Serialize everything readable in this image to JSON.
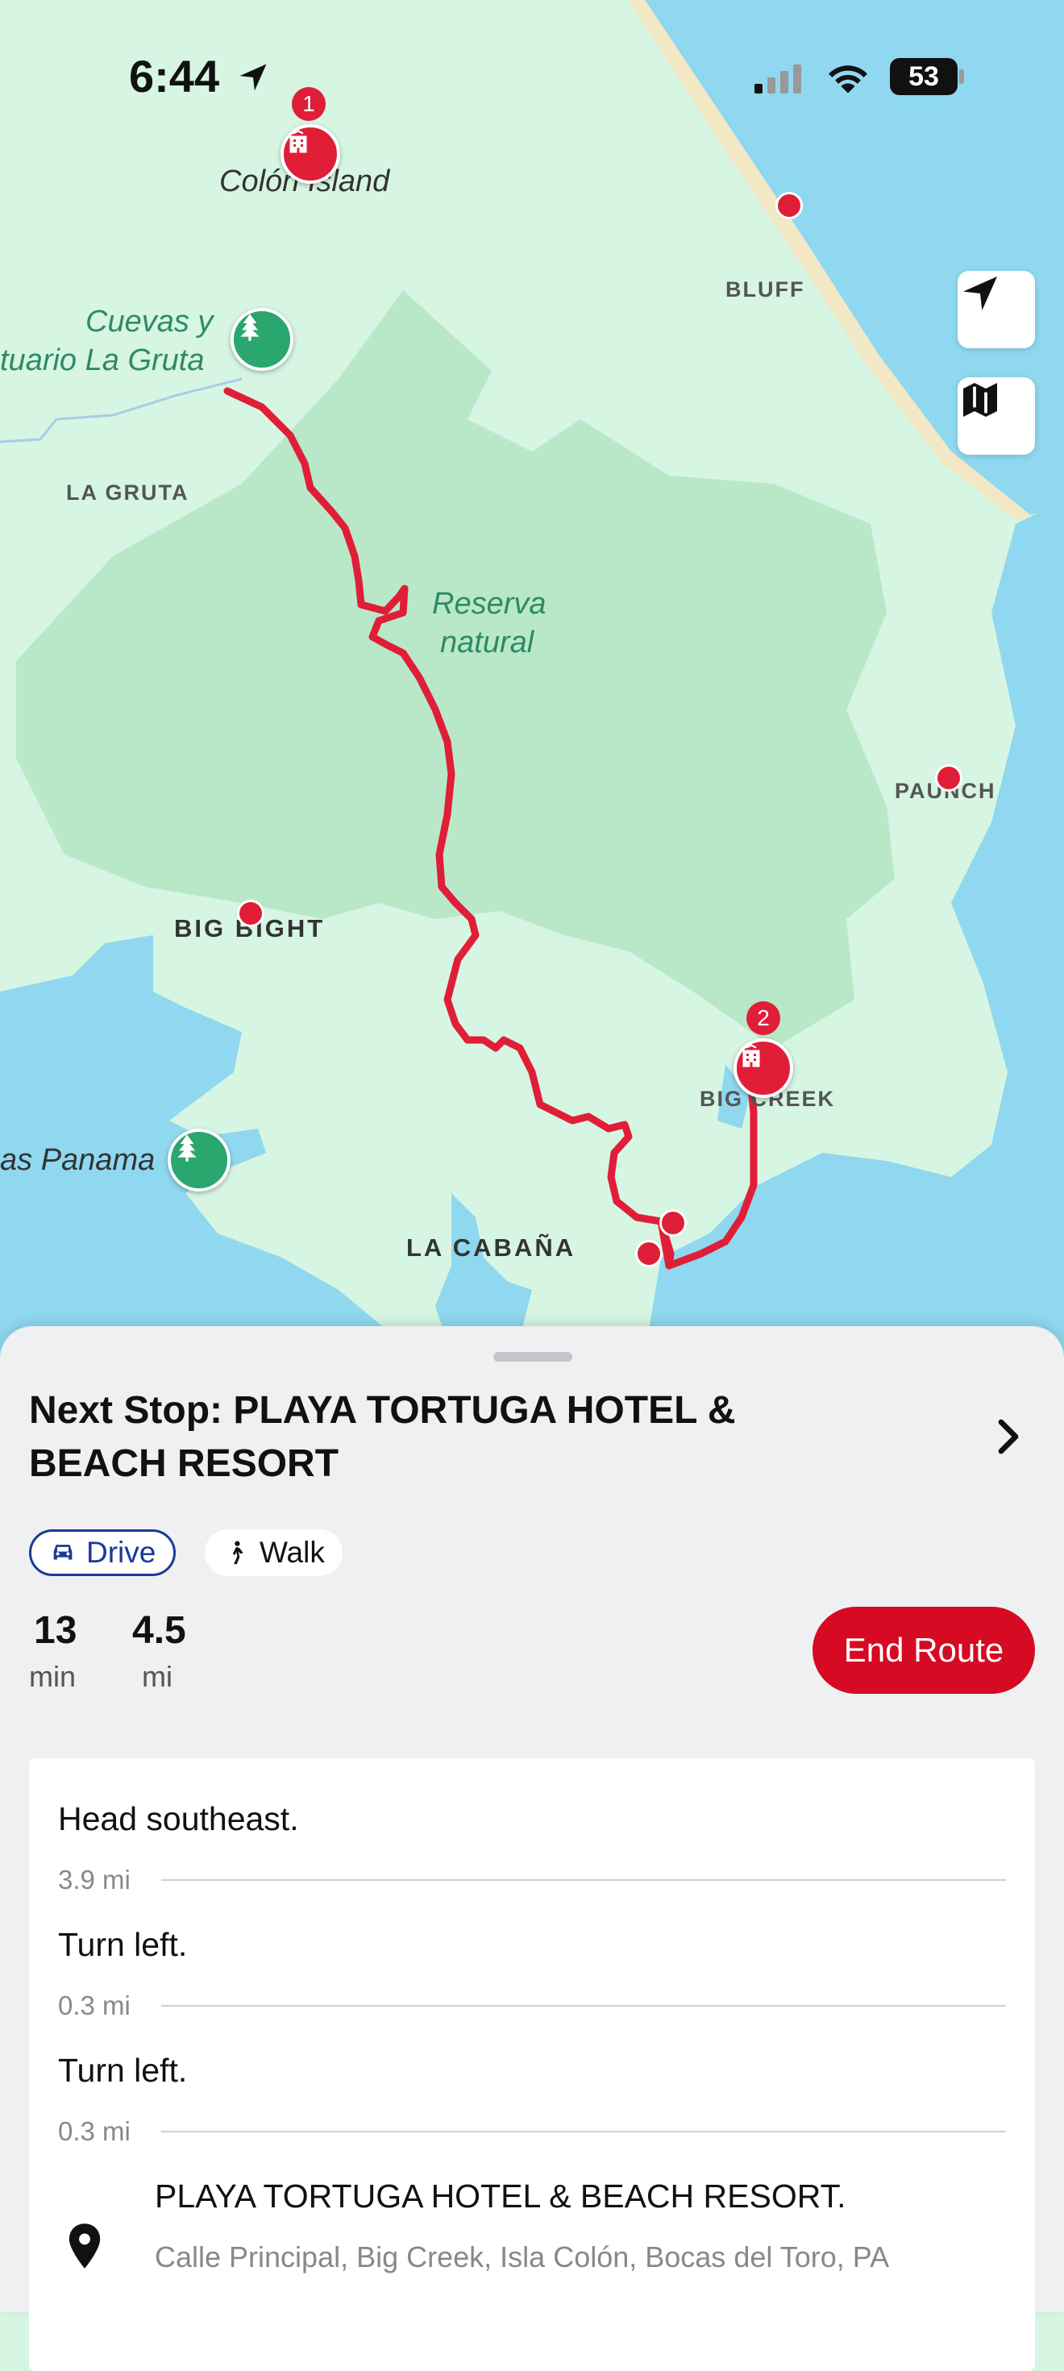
{
  "status_bar": {
    "time": "6:44",
    "battery": "53"
  },
  "map": {
    "labels": {
      "colon_island": "Colón Island",
      "cuevas_line1": "Cuevas y",
      "cuevas_line2": "tuario La Gruta",
      "la_gruta": "LA GRUTA",
      "bluff": "BLUFF",
      "reserva_line1": "Reserva",
      "reserva_line2": "natural",
      "paunch": "PAUNCH",
      "big_bight": "BIG BIGHT",
      "big_creek": "BIG CREEK",
      "panama": "as Panama",
      "la_cabana": "LA CABAÑA"
    },
    "pins": {
      "hotel_1_number": "1",
      "hotel_2_number": "2"
    },
    "buttons": {
      "locate_icon": "location-arrow-icon",
      "map_icon": "map-icon"
    },
    "colors": {
      "land": "#d6f5e3",
      "reserve": "#b9e8c9",
      "water": "#8fd8ef",
      "route": "#e01e37"
    }
  },
  "sheet": {
    "title": "Next Stop: PLAYA TORTUGA HOTEL & BEACH RESORT",
    "modes": {
      "drive": "Drive",
      "walk": "Walk"
    },
    "stats": {
      "time_value": "13",
      "time_unit": "min",
      "distance_value": "4.5",
      "distance_unit": "mi"
    },
    "end_route_label": "End Route",
    "steps": [
      {
        "instruction": "Head southeast.",
        "distance": "3.9 mi"
      },
      {
        "instruction": "Turn left.",
        "distance": "0.3 mi"
      },
      {
        "instruction": "Turn left.",
        "distance": "0.3 mi"
      }
    ],
    "destination": {
      "name": "PLAYA TORTUGA HOTEL & BEACH RESORT.",
      "address": "Calle Principal, Big Creek, Isla Colón, Bocas del Toro, PA"
    }
  }
}
